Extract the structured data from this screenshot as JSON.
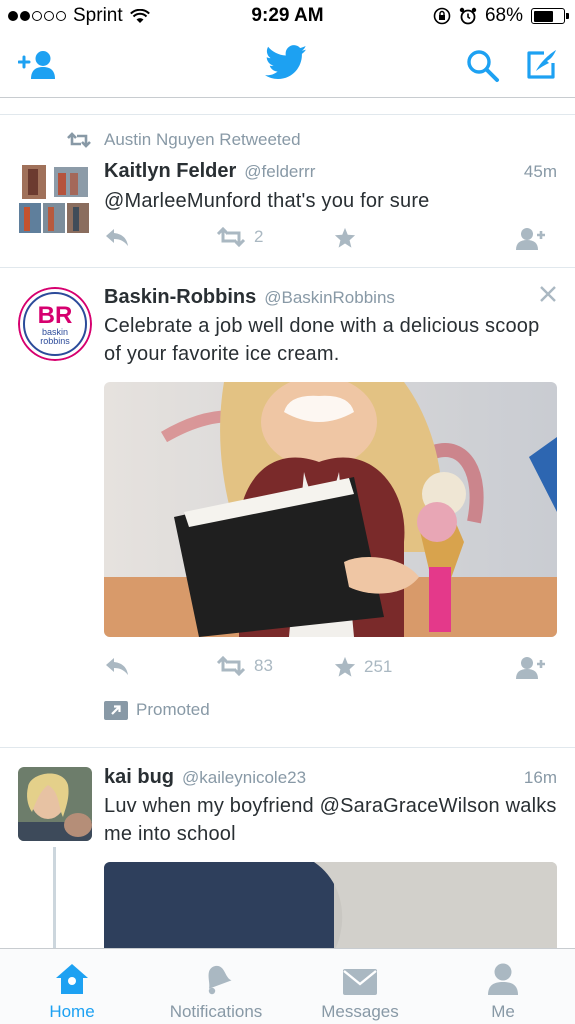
{
  "status_bar": {
    "carrier": "Sprint",
    "time": "9:29 AM",
    "battery": "68%",
    "battery_level": 0.68,
    "signal_bars": 2,
    "signal_total": 5
  },
  "nav": {
    "icons": [
      "add-user-icon",
      "twitter-bird-icon",
      "search-icon",
      "compose-icon"
    ],
    "accent_color": "#1da1f2"
  },
  "tweets": [
    {
      "retweeted_by": "Austin Nguyen Retweeted",
      "name": "Kaitlyn Felder",
      "handle": "@felderrr",
      "time": "45m",
      "text": "@MarleeMunford that's you for sure",
      "retweets": "2",
      "likes": ""
    },
    {
      "name": "Baskin-Robbins",
      "handle": "@BaskinRobbins",
      "text": "Celebrate a job well done with a delicious scoop of your favorite ice cream.",
      "retweets": "83",
      "likes": "251",
      "promoted": "Promoted",
      "avatar_text": "BR",
      "avatar_sub": "baskin robbins"
    },
    {
      "name": "kai bug",
      "handle": "@kaileynicole23",
      "time": "16m",
      "text": "Luv when my boyfriend @SaraGraceWilson walks me into school"
    }
  ],
  "tabs": [
    {
      "label": "Home",
      "icon": "home-icon",
      "active": true
    },
    {
      "label": "Notifications",
      "icon": "bell-icon",
      "active": false
    },
    {
      "label": "Messages",
      "icon": "envelope-icon",
      "active": false
    },
    {
      "label": "Me",
      "icon": "person-icon",
      "active": false
    }
  ]
}
